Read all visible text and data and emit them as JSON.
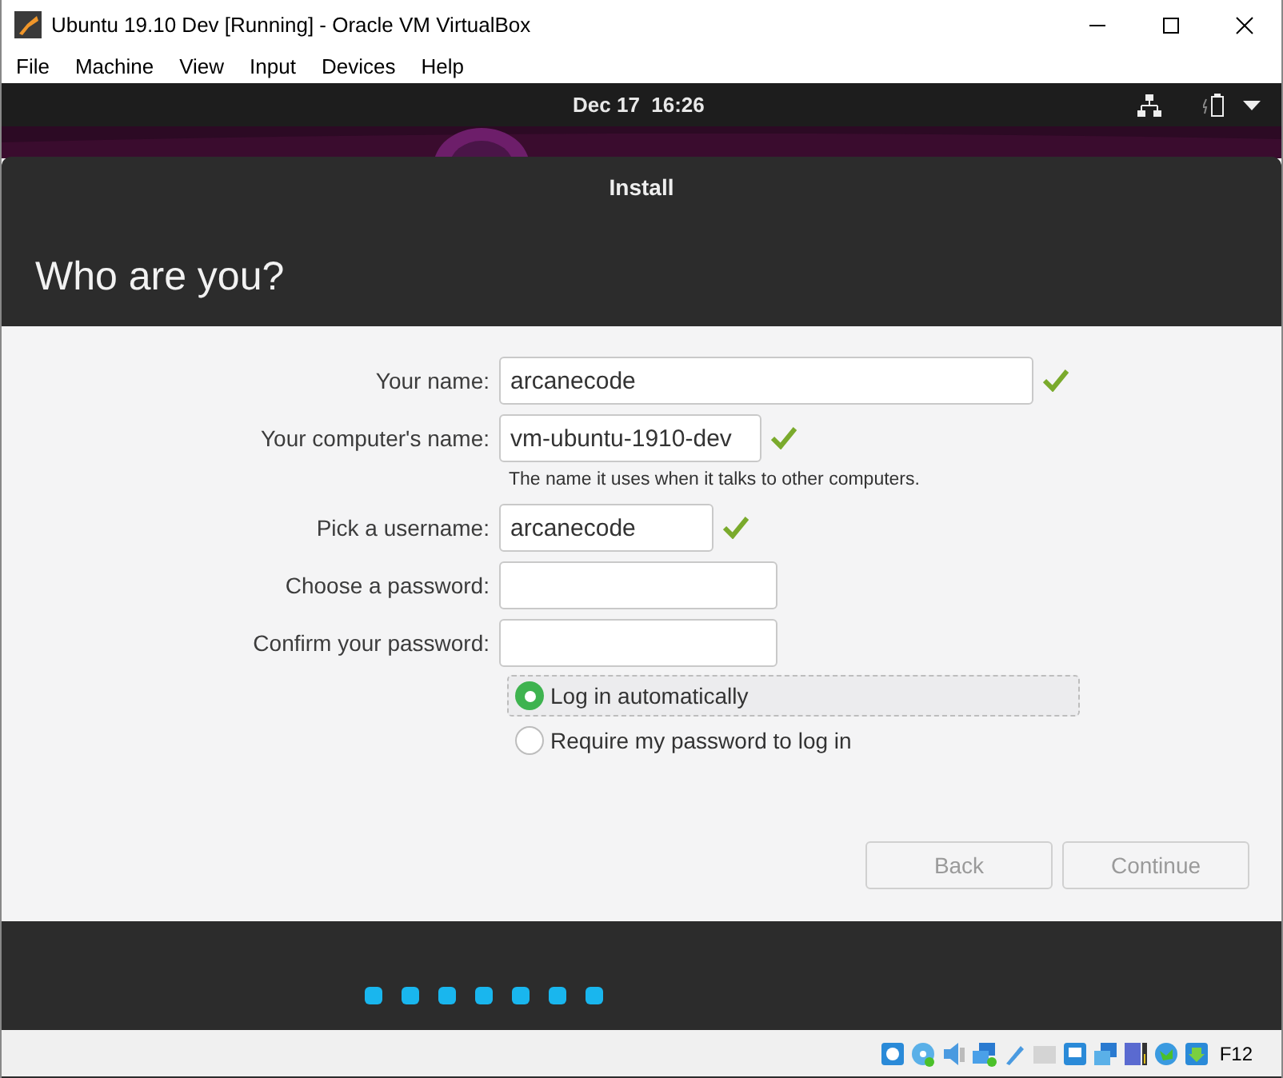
{
  "window": {
    "title": "Ubuntu 19.10 Dev [Running] - Oracle VM VirtualBox"
  },
  "menu": [
    "File",
    "Machine",
    "View",
    "Input",
    "Devices",
    "Help"
  ],
  "top_bar": {
    "clock": "Dec 17  16:26"
  },
  "installer": {
    "title": "Install",
    "heading": "Who are you?",
    "fields": [
      {
        "label": "Your name:",
        "value": "arcanecode",
        "valid": true
      },
      {
        "label": "Your computer's name:",
        "value": "vm-ubuntu-1910-dev",
        "valid": true,
        "hint": "The name it uses when it talks to other computers."
      },
      {
        "label": "Pick a username:",
        "value": "arcanecode",
        "valid": true
      },
      {
        "label": "Choose a password:",
        "valid": false
      },
      {
        "label": "Confirm your password:",
        "valid": false
      }
    ],
    "login_options": [
      {
        "label": "Log in automatically",
        "selected": true
      },
      {
        "label": "Require my password to log in",
        "selected": false
      }
    ],
    "buttons": [
      {
        "label": "Back",
        "disabled": true
      },
      {
        "label": "Continue",
        "disabled": true
      }
    ],
    "progress_dots": [
      {
        "done": true
      },
      {
        "done": true
      },
      {
        "done": true
      },
      {
        "done": true
      },
      {
        "done": true
      },
      {
        "done": true
      },
      {
        "done": true
      }
    ]
  },
  "status_bar": {
    "host_key": "F12"
  }
}
